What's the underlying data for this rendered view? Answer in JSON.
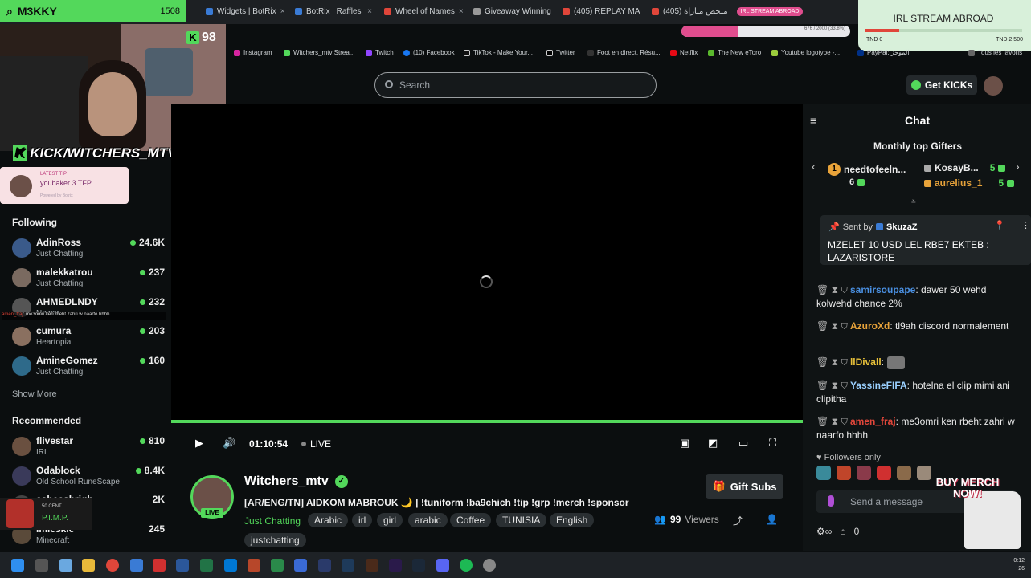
{
  "browser": {
    "first_tab": {
      "title": "M3KKY",
      "count": "1508"
    },
    "tabs": [
      {
        "title": "Widgets | BotRix",
        "color": "#3a7bd5"
      },
      {
        "title": "BotRix | Raffles",
        "color": "#3a7bd5"
      },
      {
        "title": "Wheel of Names",
        "color": "#e0463a"
      },
      {
        "title": "Giveaway Winning",
        "color": "#999999"
      },
      {
        "title": "(405) REPLAY MA",
        "color": "#e0463a"
      },
      {
        "title": "(405) ملخص مباراة",
        "color": "#e0463a"
      }
    ],
    "bookmarks": [
      "Instagram",
      "Witchers_mtv Strea...",
      "Twitch",
      "(10) Facebook",
      "TikTok - Make Your...",
      "Twitter",
      "Foot en direct, Résu...",
      "Netflix",
      "The New eToro",
      "Youtube logotype -...",
      "PayPal: الموجز",
      "Tous les favoris"
    ]
  },
  "overlay": {
    "irl_tab_label": "IRL STREAM ABROAD",
    "irl_banner_value": "676 / 2000 (33.8%)",
    "irl_card_title": "IRL STREAM ABROAD",
    "irl_card_low": "TND 0",
    "irl_card_high": "TND 2,500",
    "irl_progress": 0.22,
    "kick_count": "98",
    "kick_prefix": "K",
    "kick_handle": "KICK/WITCHERS_MTV",
    "tip_label": "LATEST TIP",
    "tip_text": "youbaker 3 TFP",
    "tip_sub": "Powered by Botrix",
    "amen_overlay_user": "amen_fraj",
    "amen_overlay_msg": ": me3omri ken rbeht zahri w naarfo hhhh",
    "pimp_label": "50 CENT",
    "pimp_title": "P.I.M.P.",
    "buy_merch": "BUY MERCH NOW!"
  },
  "header": {
    "search_placeholder": "Search",
    "get_kicks": "Get KICKs"
  },
  "sidebar": {
    "following_label": "Following",
    "following": [
      {
        "name": "AdinRoss",
        "category": "Just Chatting",
        "viewers": "24.6K",
        "color": "#3a5a8a"
      },
      {
        "name": "malekkatrou",
        "category": "Just Chatting",
        "viewers": "237",
        "color": "#7a6a60"
      },
      {
        "name": "AHMEDLNDY",
        "category": "Newar",
        "viewers": "232",
        "color": "#555555"
      },
      {
        "name": "cumura",
        "category": "Heartopia",
        "viewers": "203",
        "color": "#8a7060"
      },
      {
        "name": "AmineGomez",
        "category": "Just Chatting",
        "viewers": "160",
        "color": "#2e6a8a"
      }
    ],
    "show_more": "Show More",
    "recommended_label": "Recommended",
    "recommended": [
      {
        "name": "flivestar",
        "category": "IRL",
        "viewers": "810",
        "color": "#6a5040"
      },
      {
        "name": "Odablock",
        "category": "Old School RuneScape",
        "viewers": "8.4K",
        "color": "#3a3a5a"
      },
      {
        "name": "asheeshrigh",
        "category": "",
        "viewers": "2K",
        "color": "#444444"
      },
      {
        "name": "Imleskie",
        "category": "Minecraft",
        "viewers": "245",
        "color": "#5a4a3a"
      }
    ]
  },
  "player": {
    "time": "01:10:54",
    "live": "LIVE"
  },
  "stream": {
    "live_badge": "LIVE",
    "name": "Witchers_mtv",
    "title": "[AR/ENG/TN] AIDKOM MABROUK 🌙 | !tuniform !ba9chich !tip !grp !merch !sponsor",
    "category": "Just Chatting",
    "tags": [
      "Arabic",
      "irl",
      "girl",
      "arabic",
      "Coffee",
      "TUNISIA",
      "English"
    ],
    "extra_tag": "justchatting",
    "gift_subs": "Gift Subs",
    "viewers_count": "99",
    "viewers_label": "Viewers"
  },
  "chat": {
    "title": "Chat",
    "gifters_heading": "Monthly top Gifters",
    "gifters": [
      {
        "rank": "1",
        "name": "needtofeeln...",
        "count": "6"
      },
      {
        "name": "KosayB...",
        "count": "5"
      },
      {
        "name": "aurelius_1",
        "count": "5"
      }
    ],
    "pinned": {
      "sent_by_label": "Sent by",
      "sender": "SkuzaZ",
      "message": "MZELET 10 USD LEL RBE7 EKTEB : LAZARISTORE"
    },
    "messages": [
      {
        "user": "samirsoupape",
        "color": "#4a90e2",
        "text": ": dawer 50 wehd kolwehd chance 2%"
      },
      {
        "user": "AzuroXd",
        "color": "#e8a33a",
        "text": ": tl9ah discord normalement"
      },
      {
        "user": "llDivall",
        "color": "#e8c13a",
        "text": ":"
      },
      {
        "user": "YassineFIFA",
        "color": "#9ad0ff",
        "text": ": hotelna el clip mimi ani clipitha"
      },
      {
        "user": "amen_fraj",
        "color": "#e0463a",
        "text": ": me3omri ken rbeht zahri w naarfo hhhh"
      }
    ],
    "followers_only": "Followers only",
    "send_placeholder": "Send a message",
    "bottom_count": "0"
  },
  "taskbar": {
    "clock_time": "0:12",
    "clock_date": "26"
  }
}
